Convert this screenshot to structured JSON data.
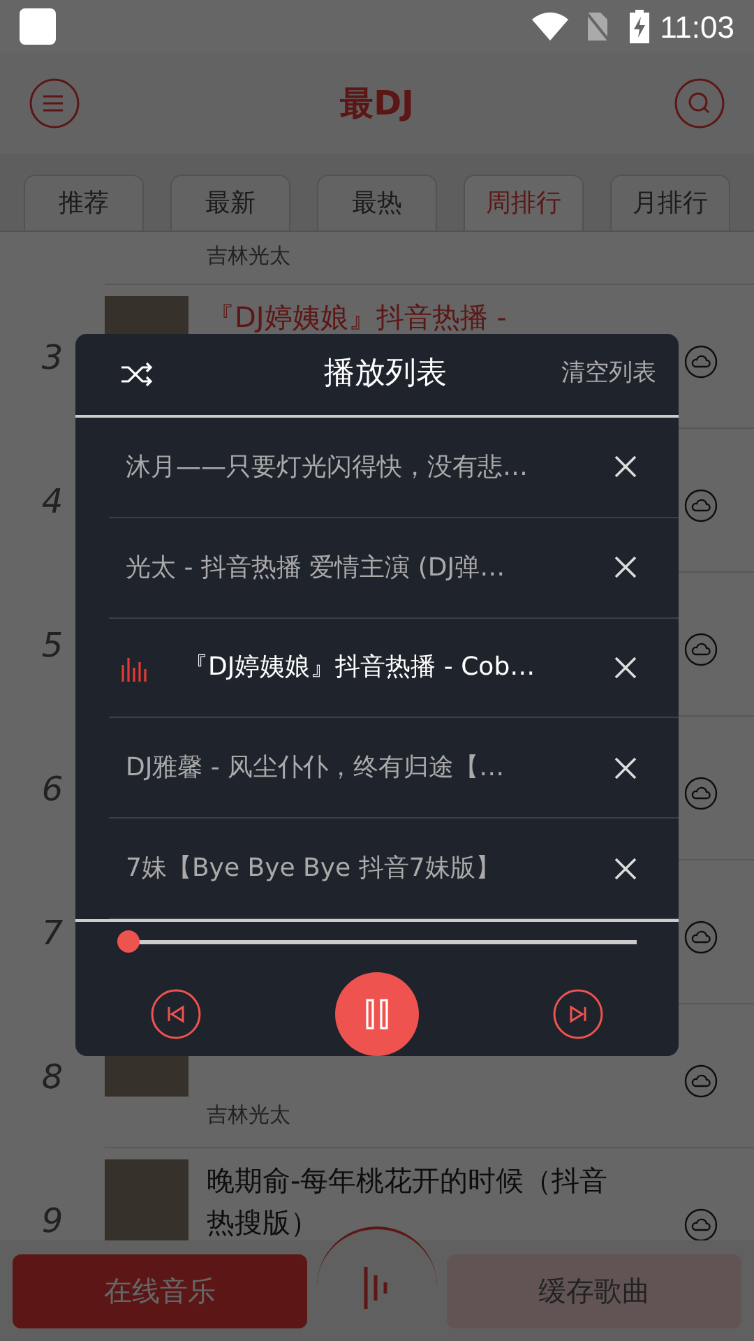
{
  "status_bar": {
    "time": "11:03"
  },
  "header": {
    "title": "最DJ"
  },
  "tabs": [
    {
      "label": "推荐",
      "selected": false
    },
    {
      "label": "最新",
      "selected": false
    },
    {
      "label": "最热",
      "selected": false
    },
    {
      "label": "周排行",
      "selected": true
    },
    {
      "label": "月排行",
      "selected": false
    }
  ],
  "songs": [
    {
      "kind": "partial",
      "artist": "吉林光太"
    },
    {
      "kind": "row",
      "number": "3",
      "title": "『DJ婷姨娘』抖音热播 -",
      "playing": true
    },
    {
      "kind": "row",
      "number": "4"
    },
    {
      "kind": "row",
      "number": "5"
    },
    {
      "kind": "row",
      "number": "6"
    },
    {
      "kind": "row",
      "number": "7"
    },
    {
      "kind": "row",
      "number": "8",
      "artist": "吉林光太"
    },
    {
      "kind": "row",
      "number": "9",
      "title": "晚期俞-每年桃花开的时候（抖音热搜版）",
      "playing": false
    }
  ],
  "playlist": {
    "title": "播放列表",
    "clear": "清空列表",
    "playing": true,
    "items": [
      {
        "title": "沐月——只要灯光闪得快，没有悲…",
        "playing": false
      },
      {
        "title": "光太 - 抖音热播 爱情主演 (DJ弹…",
        "playing": false
      },
      {
        "title": "『DJ婷姨娘』抖音热播 - Cob…",
        "playing": true
      },
      {
        "title": "DJ雅馨 - 风尘仆仆，终有归途【…",
        "playing": false
      },
      {
        "title": "7妹【Bye Bye Bye 抖音7妹版】",
        "playing": false
      }
    ],
    "progress": {
      "level": 0
    }
  },
  "bottom_nav": [
    {
      "label": "在线音乐",
      "selected": true
    },
    {
      "label": "缓存歌曲",
      "selected": false
    }
  ]
}
